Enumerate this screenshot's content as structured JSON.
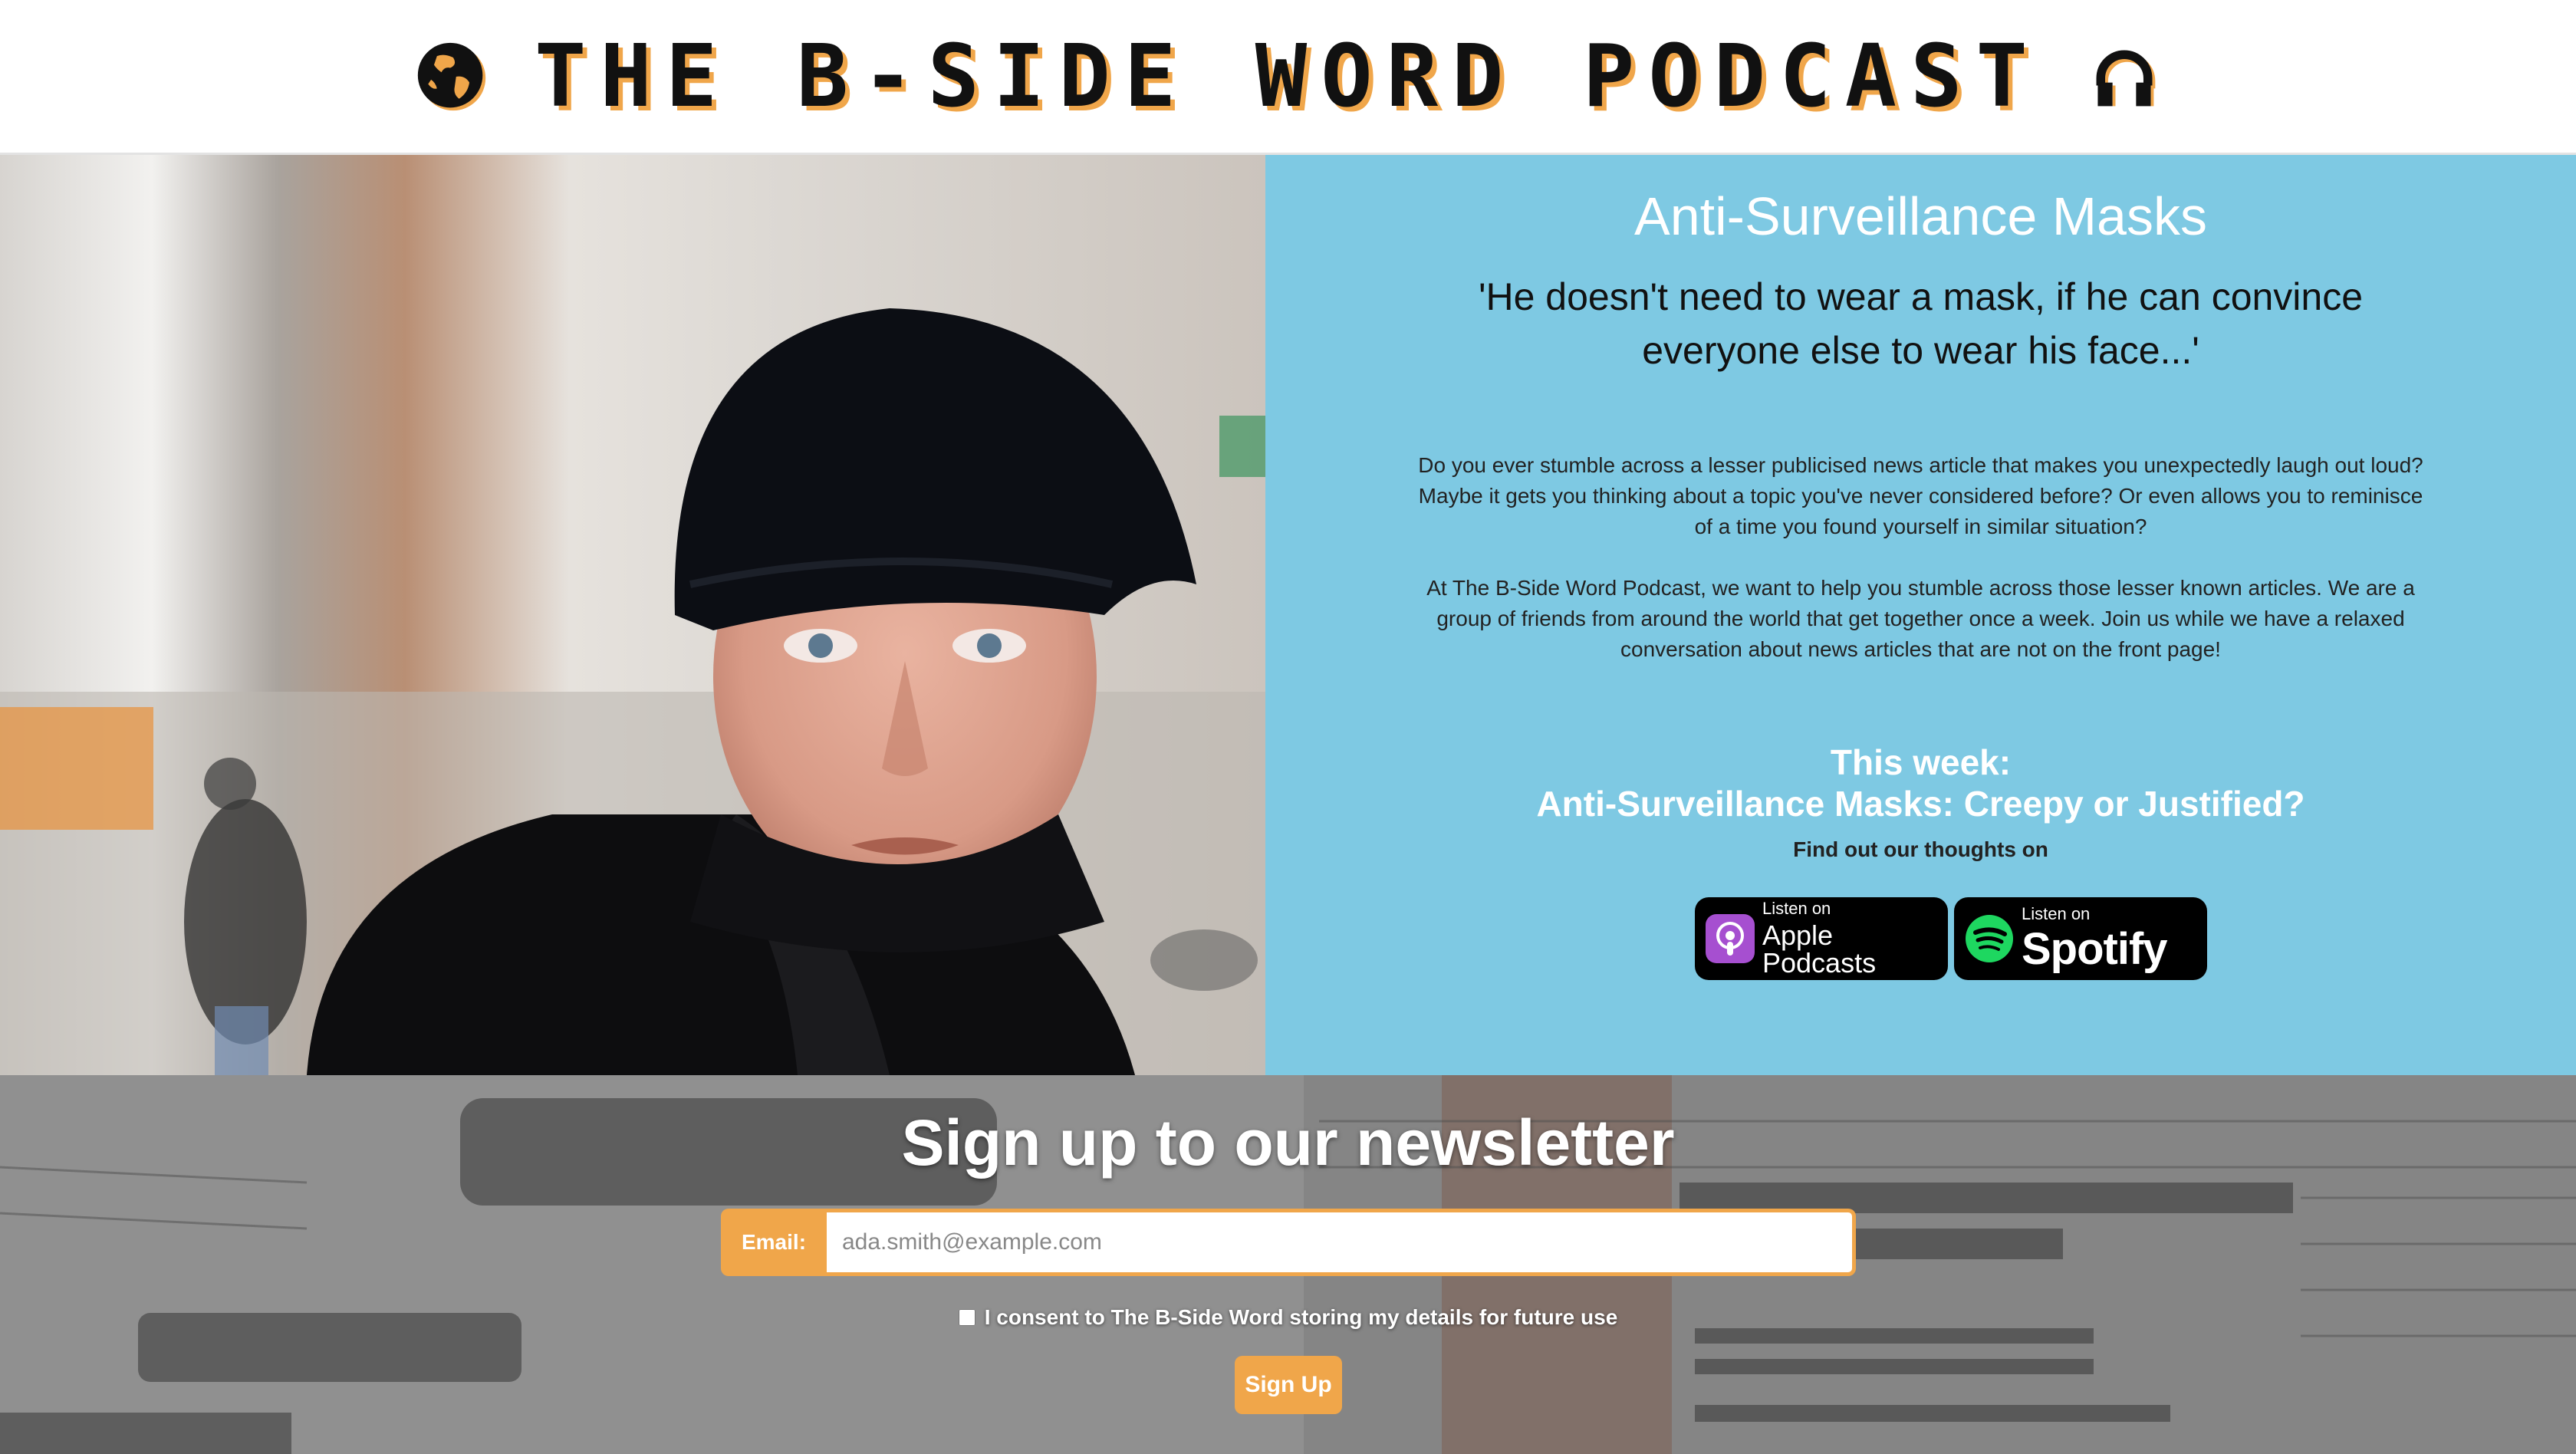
{
  "header": {
    "title": "THE B-SIDE WORD PODCAST",
    "left_icon": "globe-icon",
    "right_icon": "headphones-icon"
  },
  "hero": {
    "image": "man-in-beanie-photo",
    "episode_title": "Anti-Surveillance Masks",
    "quote": "'He doesn't need to wear a mask, if he can convince everyone else to wear his face...'",
    "intro_paragraphs": [
      "Do you ever stumble across a lesser publicised news article that makes you unexpectedly laugh out loud? Maybe it gets you thinking about a topic you've never considered before? Or even allows you to reminisce of a time you found yourself in similar situation?",
      "At The B-Side Word Podcast, we want to help you stumble across those lesser known articles. We are a group of friends from around the world that get together once a week. Join us while we have a relaxed conversation about news articles that are not on the front page!"
    ],
    "this_week_label": "This week:",
    "this_week_title": "Anti-Surveillance Masks: Creepy or Justified?",
    "find_out": "Find out our thoughts on",
    "badges": {
      "apple": {
        "small": "Listen on",
        "big": "Apple Podcasts",
        "icon": "apple-podcasts-icon"
      },
      "spotify": {
        "small": "Listen on",
        "big": "Spotify",
        "icon": "spotify-icon"
      }
    }
  },
  "newsletter": {
    "title": "Sign up to our newsletter",
    "email_label": "Email:",
    "email_placeholder": "ada.smith@example.com",
    "consent": "I consent to The B-Side Word storing my details for future use",
    "button": "Sign Up",
    "background_image": "vintage-newspapers-photo"
  },
  "colors": {
    "accent_orange": "#f0a64a",
    "hero_blue": "#7ec9e3"
  }
}
